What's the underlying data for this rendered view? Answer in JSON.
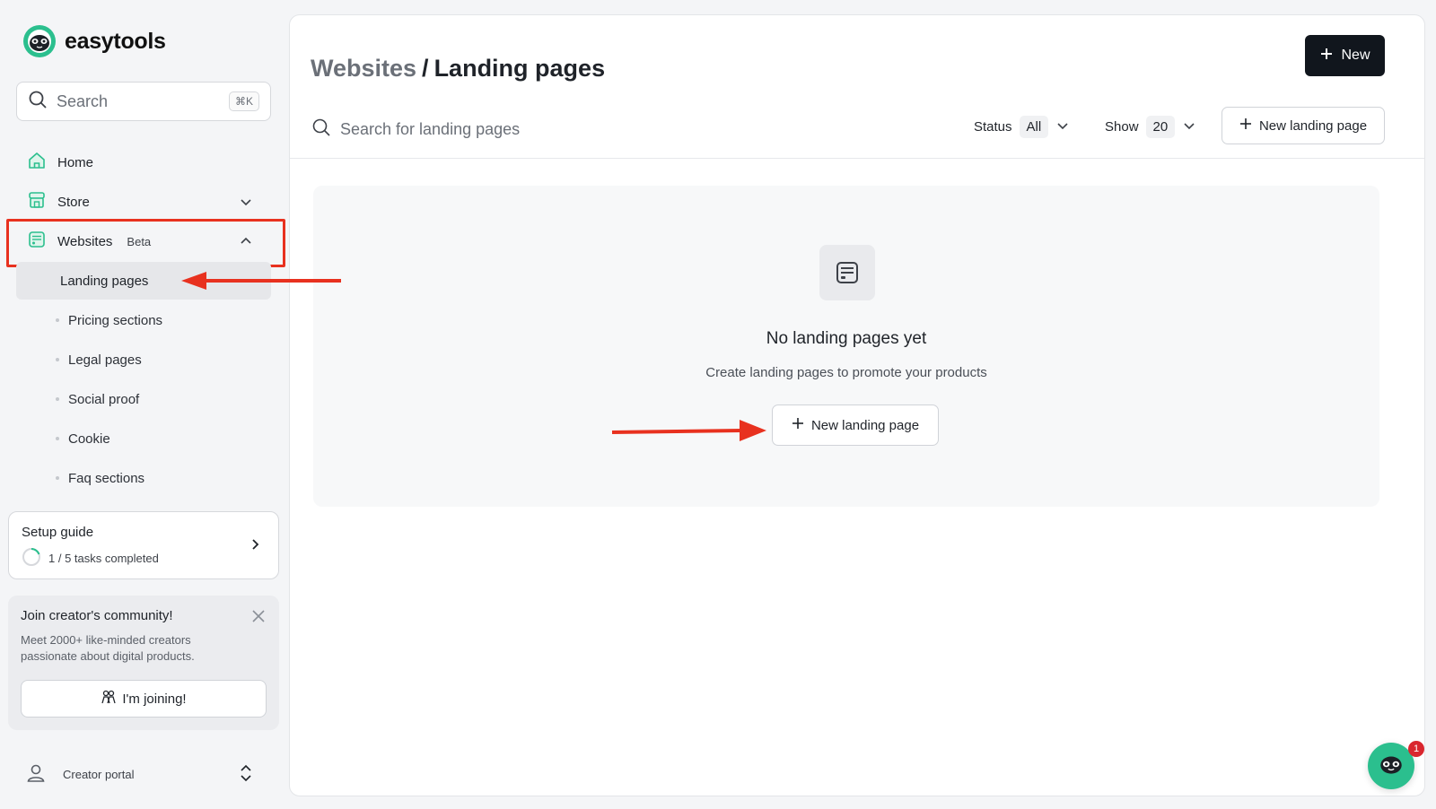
{
  "brand": {
    "name": "easytools"
  },
  "sidebar": {
    "search": {
      "placeholder": "Search",
      "shortcut": "⌘K"
    },
    "nav": [
      {
        "label": "Home",
        "icon": "home-icon"
      },
      {
        "label": "Store",
        "icon": "store-icon"
      },
      {
        "label": "Websites",
        "badge": "Beta",
        "icon": "websites-icon"
      }
    ],
    "sub_items": [
      "Landing pages",
      "Pricing sections",
      "Legal pages",
      "Social proof",
      "Cookie",
      "Faq sections"
    ],
    "setup": {
      "title": "Setup guide",
      "progress_text": "1 / 5 tasks completed",
      "completed": 1,
      "total": 5
    },
    "community": {
      "title": "Join creator's community!",
      "text": "Meet 2000+ like-minded creators passionate about digital products.",
      "button": "I'm joining!"
    },
    "portal": {
      "label": "Creator portal"
    }
  },
  "main": {
    "breadcrumb": {
      "parent": "Websites",
      "separator": "/",
      "current": "Landing pages"
    },
    "new_button": "New",
    "toolbar": {
      "search_placeholder": "Search for landing pages",
      "status_label": "Status",
      "status_value": "All",
      "show_label": "Show",
      "show_value": "20",
      "new_landing_button": "New landing page"
    },
    "empty": {
      "title": "No landing pages yet",
      "subtitle": "Create landing pages to promote your products",
      "button": "New landing page"
    }
  },
  "chat": {
    "badge": "1"
  },
  "colors": {
    "accent": "#2bbf8e",
    "annotation": "#e8311f",
    "primary_button": "#11161d",
    "badge": "#d9262e"
  }
}
